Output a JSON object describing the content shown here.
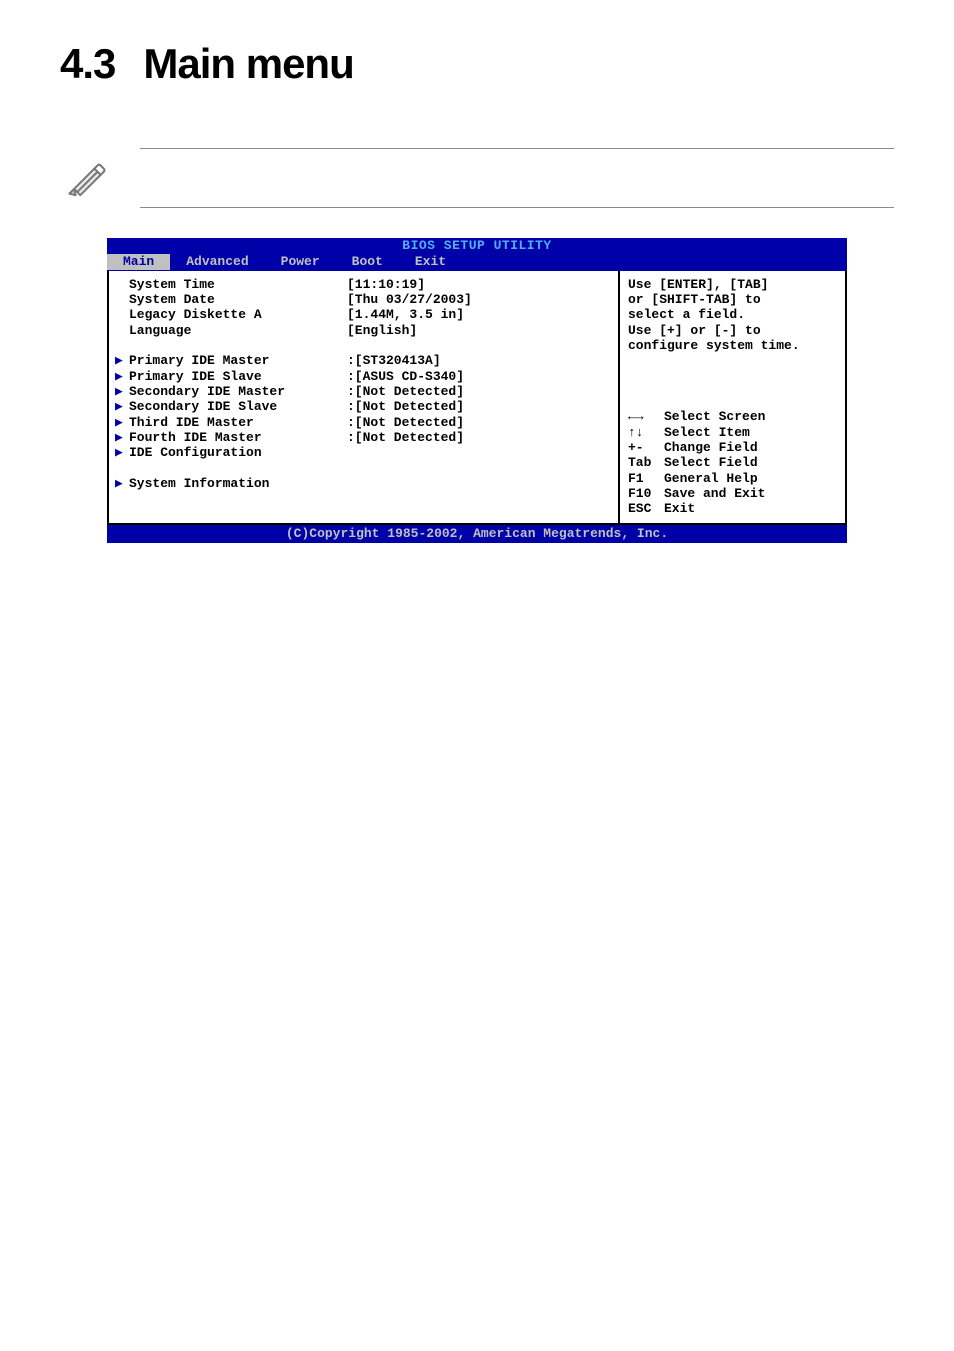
{
  "page": {
    "heading_num": "4.3",
    "heading_text": "Main menu"
  },
  "bios": {
    "title_bar": "BIOS SETUP UTILITY",
    "tabs": {
      "main": "Main",
      "advanced": "Advanced",
      "power": "Power",
      "boot": "Boot",
      "exit": "Exit"
    },
    "rows": {
      "system_time_label": "System Time",
      "system_time_value": "[11:10:19]",
      "system_date_label": "System Date",
      "system_date_value": "[Thu 03/27/2003]",
      "legacy_label": "Legacy Diskette A",
      "legacy_value": "[1.44M, 3.5 in]",
      "language_label": "Language",
      "language_value": "[English]",
      "pri_ide_master_label": "Primary IDE Master",
      "pri_ide_master_value": ":[ST320413A]",
      "pri_ide_slave_label": "Primary IDE Slave",
      "pri_ide_slave_value": ":[ASUS CD-S340]",
      "sec_ide_master_label": "Secondary IDE Master",
      "sec_ide_master_value": ":[Not Detected]",
      "sec_ide_slave_label": "Secondary IDE Slave",
      "sec_ide_slave_value": ":[Not Detected]",
      "third_ide_master_label": "Third IDE Master",
      "third_ide_master_value": ":[Not Detected]",
      "fourth_ide_master_label": "Fourth IDE Master",
      "fourth_ide_master_value": ":[Not Detected]",
      "ide_config_label": "IDE Configuration",
      "sys_info_label": "System Information"
    },
    "help": {
      "lines": [
        "Use [ENTER], [TAB]",
        "or [SHIFT-TAB] to",
        "select a field.",
        "",
        "Use [+] or [-] to",
        "configure system time."
      ],
      "keys": {
        "select_screen": "Select Screen",
        "select_item": "Select Item",
        "change_field_k": "+-",
        "change_field": "Change Field",
        "select_field_k": "Tab",
        "select_field": "Select Field",
        "general_help_k": "F1",
        "general_help": "General Help",
        "save_exit_k": "F10",
        "save_exit": "Save and Exit",
        "exit_k": "ESC",
        "exit": "Exit"
      }
    },
    "footer": "(C)Copyright 1985-2002, American Megatrends, Inc."
  }
}
